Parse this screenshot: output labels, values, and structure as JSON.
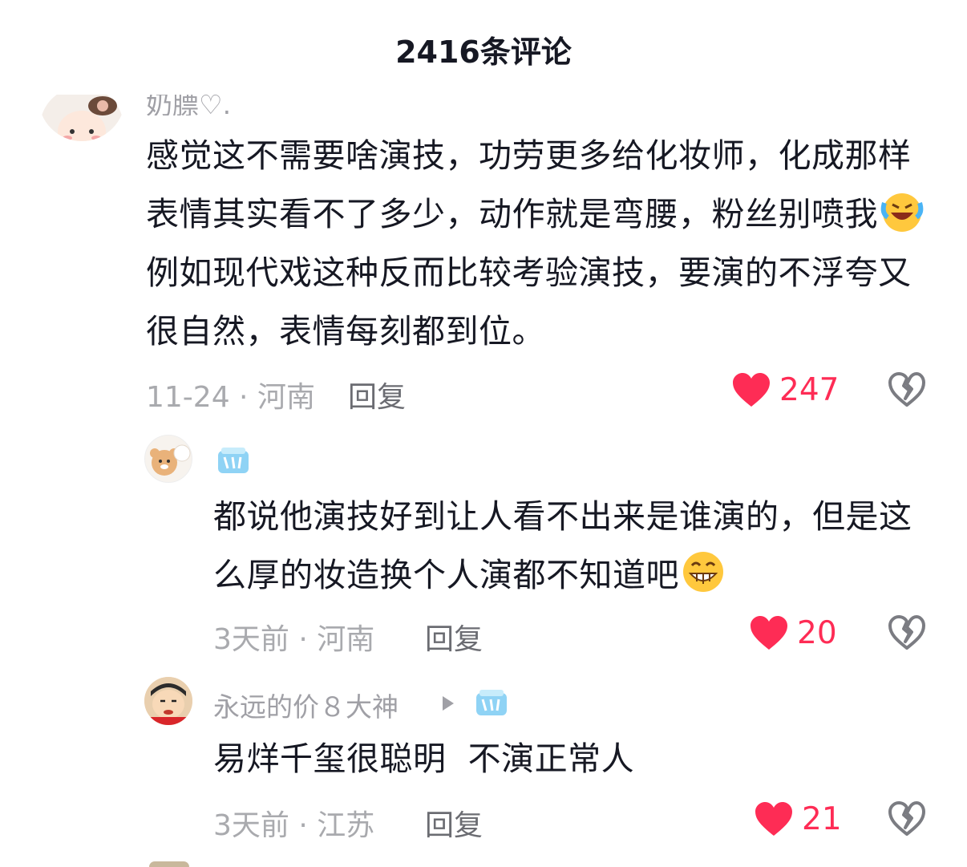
{
  "header": {
    "title": "2416条评论"
  },
  "comments": [
    {
      "username": "奶膘♡.",
      "text_part1": "感觉这不需要啥演技，功劳更多给化妆师，化成那样表情其实看不了多少，动作就是弯腰，粉丝别喷我",
      "emoji1": "laughing-crying-emoji",
      "text_part2": "例如现代戏这种反而比较考验演技，要演的不浮夸又很自然，表情每刻都到位。",
      "time_location": "11-24 · 河南",
      "reply_label": "回复",
      "likes": "247"
    },
    {
      "username": "",
      "badge": "ice-cube-badge",
      "text_part1": "都说他演技好到让人看不出来是谁演的，但是这么厚的妆造换个人演都不知道吧",
      "emoji1": "grinning-emoji",
      "time_location": "3天前 · 河南",
      "reply_label": "回复",
      "likes": "20"
    },
    {
      "username": "永远的价８大神",
      "badge": "ice-cube-badge",
      "text_part1": "易烊千玺很聪明  不演正常人",
      "time_location": "3天前 · 江苏",
      "reply_label": "回复",
      "likes": "21"
    }
  ],
  "colors": {
    "like_red": "#fe2c55",
    "meta_gray": "#a9aaae",
    "text": "#161823"
  }
}
